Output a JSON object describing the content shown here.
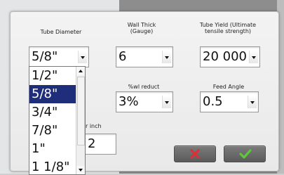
{
  "labels": {
    "tube_diameter": "Tube Diameter",
    "wall_thick_line1": "Wall Thick",
    "wall_thick_line2": "(Gauge)",
    "tube_yield_line1": "Tube Yield (Ultimate",
    "tube_yield_line2": "tensile strength)",
    "wl_reduct": "%wl reduct",
    "feed_angle": "Feed Angle",
    "per_inch_partial": "per inch"
  },
  "fields": {
    "tube_diameter": "5/8\"",
    "wall_thick": "6",
    "tube_yield": "20 000",
    "wl_reduct": "3%",
    "feed_angle": "0.5",
    "per_inch": "2"
  },
  "tube_diameter_options": [
    "1/2\"",
    "5/8\"",
    "3/4\"",
    "7/8\"",
    "1\"",
    "1 1/8\""
  ],
  "selected_option": "5/8\"",
  "icons": {
    "cancel": "close-icon",
    "ok": "check-icon",
    "cancel_color": "#d9303a",
    "ok_color": "#5cc83a"
  }
}
